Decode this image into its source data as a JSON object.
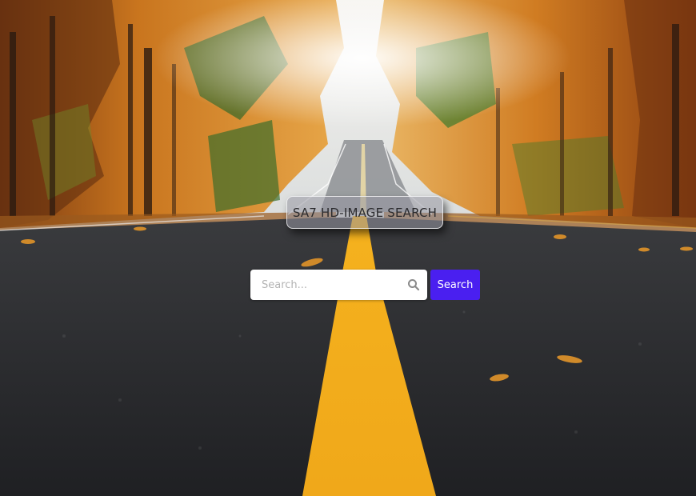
{
  "header": {
    "title": "SA7 HD-IMAGE SEARCH"
  },
  "search": {
    "placeholder": "Search...",
    "value": "",
    "icon": "magnifier-icon",
    "button_label": "Search"
  },
  "background": {
    "description_icon": "autumn-road-photo"
  },
  "colors": {
    "button": "#4a1ff0",
    "road_line": "#f2a91b"
  }
}
